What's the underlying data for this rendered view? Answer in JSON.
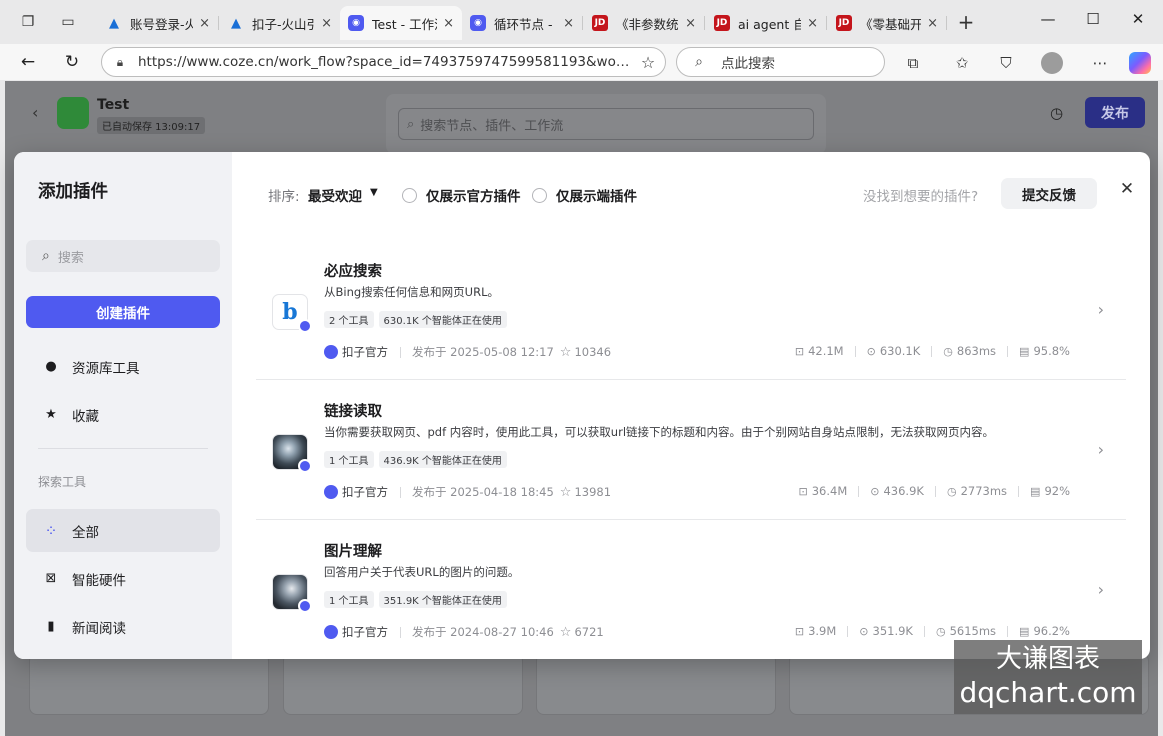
{
  "browser": {
    "tabs": [
      {
        "title": "账号登录-火",
        "favicon": "fire-icon",
        "color": "#1a6fd6"
      },
      {
        "title": "扣子-火山引",
        "favicon": "fire-icon",
        "color": "#1a6fd6"
      },
      {
        "title": "Test - 工作流",
        "favicon": "coze-icon",
        "color": "#4f5af0",
        "active": true
      },
      {
        "title": "循环节点 -",
        "favicon": "coze-icon",
        "color": "#4f5af0"
      },
      {
        "title": "《非参数统",
        "favicon": "jd-icon",
        "color": "#c4151c",
        "label": "JD"
      },
      {
        "title": "ai agent 自",
        "favicon": "jd-icon",
        "color": "#c4151c",
        "label": "JD"
      },
      {
        "title": "《零基础开",
        "favicon": "jd-icon",
        "color": "#c4151c",
        "label": "JD"
      }
    ],
    "new_tab": "+",
    "url": "https://www.coze.cn/work_flow?space_id=7493759747599581193&workfl...",
    "search_placeholder": "点此搜索"
  },
  "background": {
    "title": "Test",
    "autosave": "已自动保存 13:09:17",
    "search_placeholder": "搜索节点、插件、工作流",
    "publish": "发布"
  },
  "modal": {
    "title": "添加插件",
    "search_placeholder": "搜索",
    "create_button": "创建插件",
    "side_items": [
      {
        "label": "资源库工具",
        "icon": "user-icon"
      },
      {
        "label": "收藏",
        "icon": "star-icon"
      }
    ],
    "group_label": "探索工具",
    "category_items": [
      {
        "label": "全部",
        "icon": "grid-icon",
        "active": true
      },
      {
        "label": "智能硬件",
        "icon": "chip-icon"
      },
      {
        "label": "新闻阅读",
        "icon": "book-icon"
      }
    ],
    "sort_label": "排序:",
    "sort_value": "最受欢迎",
    "filter_official": "仅展示官方插件",
    "filter_cloud": "仅展示端插件",
    "hint": "没找到想要的插件?",
    "feedback": "提交反馈",
    "accent_color": "#4f5af0"
  },
  "plugins": [
    {
      "name": "必应搜索",
      "desc": "从Bing搜索任何信息和网页URL。",
      "tags": [
        "2 个工具",
        "630.1K 个智能体正在使用"
      ],
      "publisher": "扣子官方",
      "published": "发布于 2025-05-08 12:17",
      "stars": "10346",
      "calls": "42.1M",
      "bots": "630.1K",
      "latency": "863ms",
      "success": "95.8%",
      "logo": "bing-logo"
    },
    {
      "name": "链接读取",
      "desc": "当你需要获取网页、pdf 内容时，使用此工具，可以获取url链接下的标题和内容。由于个别网站自身站点限制，无法获取网页内容。",
      "tags": [
        "1 个工具",
        "436.9K 个智能体正在使用"
      ],
      "publisher": "扣子官方",
      "published": "发布于 2025-04-18 18:45",
      "stars": "13981",
      "calls": "36.4M",
      "bots": "436.9K",
      "latency": "2773ms",
      "success": "92%",
      "logo": "robot-logo"
    },
    {
      "name": "图片理解",
      "desc": "回答用户关于代表URL的图片的问题。",
      "tags": [
        "1 个工具",
        "351.9K 个智能体正在使用"
      ],
      "publisher": "扣子官方",
      "published": "发布于 2024-08-27 10:46",
      "stars": "6721",
      "calls": "3.9M",
      "bots": "351.9K",
      "latency": "5615ms",
      "success": "96.2%",
      "logo": "robot-logo"
    }
  ],
  "watermark": {
    "line1": "大谦图表",
    "line2": "dqchart.com"
  }
}
